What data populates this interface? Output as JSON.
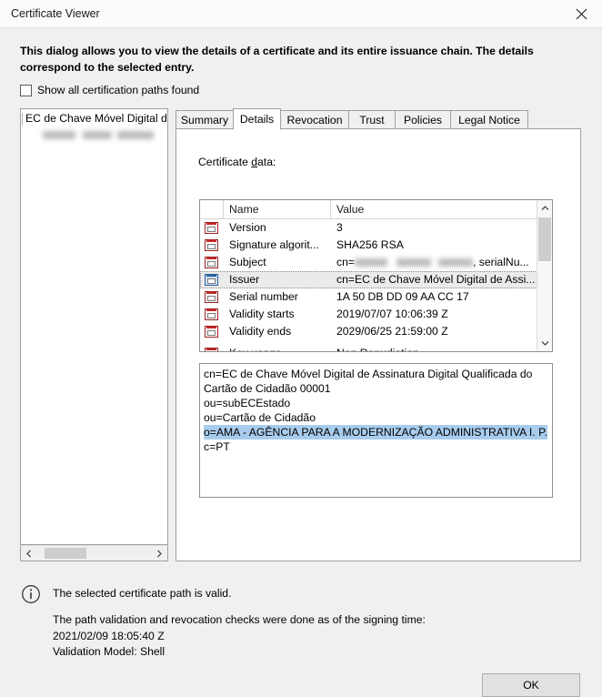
{
  "window": {
    "title": "Certificate Viewer",
    "close_icon": "close-icon"
  },
  "intro": {
    "text": "This dialog allows you to view the details of a certificate and its entire issuance chain. The details correspond to the selected entry."
  },
  "options": {
    "show_all_paths_label": "Show all certification paths found",
    "show_all_paths_checked": false
  },
  "tree": {
    "root_label": "EC de Chave Móvel Digital d",
    "child_label_redacted": true,
    "hscroll": {
      "left_arrow": "chevron-left-icon",
      "right_arrow": "chevron-right-icon"
    }
  },
  "tabs": [
    {
      "label": "Summary",
      "active": false
    },
    {
      "label": "Details",
      "active": true
    },
    {
      "label": "Revocation",
      "active": false
    },
    {
      "label": "Trust",
      "active": false
    },
    {
      "label": "Policies",
      "active": false
    },
    {
      "label": "Legal Notice",
      "active": false
    }
  ],
  "details": {
    "section_label_pre": "Certificate ",
    "section_label_accel": "d",
    "section_label_post": "ata:",
    "columns": [
      "Name",
      "Value"
    ],
    "rows": [
      {
        "name": "Version",
        "value": "3",
        "selected": false
      },
      {
        "name": "Signature algorit...",
        "value": "SHA256 RSA",
        "selected": false
      },
      {
        "name": "Subject",
        "value_prefix": "cn=",
        "value_redacted": true,
        "value_suffix": ", serialNu...",
        "selected": false
      },
      {
        "name": "Issuer",
        "value": "cn=EC de Chave Móvel Digital de Assi...",
        "selected": true
      },
      {
        "name": "Serial number",
        "value": "1A 50 DB DD 09 AA CC 17",
        "selected": false
      },
      {
        "name": "Validity starts",
        "value": "2019/07/07 10:06:39 Z",
        "selected": false
      },
      {
        "name": "Validity ends",
        "value": "2029/06/25 21:59:00 Z",
        "selected": false
      }
    ],
    "partial_row": {
      "name": "Key usage",
      "value": "Non Repudiation"
    },
    "vscroll": {
      "up_arrow": "chevron-up-icon",
      "down_arrow": "chevron-down-icon"
    },
    "detail_lines": [
      {
        "text": "cn=EC de Chave Móvel Digital de Assinatura Digital Qualificada do Cartão de Cidadão 00001",
        "highlighted": false
      },
      {
        "text": "ou=subECEstado",
        "highlighted": false
      },
      {
        "text": "ou=Cartão de Cidadão",
        "highlighted": false
      },
      {
        "text": "o=AMA - AGÊNCIA PARA A MODERNIZAÇÃO ADMINISTRATIVA I. P.",
        "highlighted": true
      },
      {
        "text": "c=PT",
        "highlighted": false
      }
    ]
  },
  "status": {
    "icon": "info-icon",
    "valid_text": "The selected certificate path is valid.",
    "detail_text": "The path validation and revocation checks were done as of the signing time:\n2021/02/09 18:05:40 Z\nValidation Model: Shell"
  },
  "footer": {
    "ok_label": "OK"
  },
  "colors": {
    "selection_blue": "#a8cced",
    "row_selected_bg": "#ebebeb",
    "dialog_bg": "#f0f0f0",
    "panel_bg": "#ffffff",
    "cert_icon_red": "#c62828"
  }
}
